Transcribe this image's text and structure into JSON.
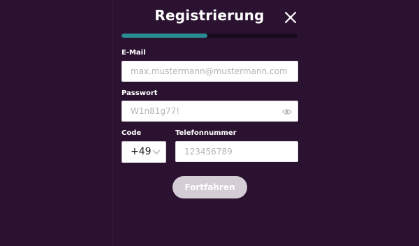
{
  "colors": {
    "background": "#2b1231",
    "divider": "#3b1e42",
    "progress_track": "#170a1b",
    "accent": "#2a8d93",
    "button_disabled": "#d4cdd5"
  },
  "dialog": {
    "title": "Registrierung",
    "close_icon": "close-icon",
    "progress": 0.49
  },
  "form": {
    "email": {
      "label": "E-Mail",
      "value": "",
      "placeholder": "max.mustermann@mustermann.com"
    },
    "password": {
      "label": "Passwort",
      "value": "",
      "placeholder": "W1n81g77!",
      "toggle_icon": "eye-icon"
    },
    "code": {
      "label": "Code",
      "selected": "+49",
      "icon": "chevron-down-icon"
    },
    "phone": {
      "label": "Telefonnummer",
      "value": "",
      "placeholder": "123456789"
    }
  },
  "actions": {
    "continue_label": "Fortfahren"
  }
}
